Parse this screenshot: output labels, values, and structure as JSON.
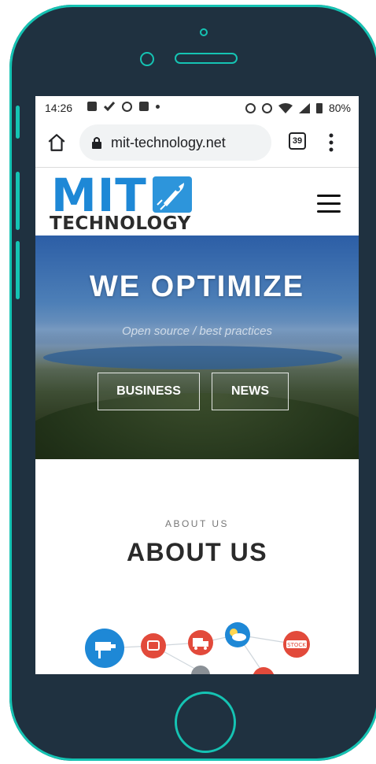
{
  "status_bar": {
    "time": "14:26",
    "battery": "80%"
  },
  "browser": {
    "url": "mit-technology.net",
    "tab_count": "39"
  },
  "site": {
    "logo_primary": "MIT",
    "logo_secondary": "TECHNOLOGY"
  },
  "hero": {
    "title": "WE OPTIMIZE",
    "subtitle": "Open source / best practices",
    "buttons": [
      {
        "label": "BUSINESS"
      },
      {
        "label": "NEWS"
      }
    ]
  },
  "about": {
    "kicker": "ABOUT US",
    "title": "ABOUT US",
    "network_icons": [
      "camera-icon",
      "chat-icon",
      "truck-icon",
      "weather-icon",
      "stock-icon"
    ],
    "network_stock_label": "STOCK"
  },
  "colors": {
    "phone_frame": "#1f3140",
    "phone_accent": "#15c3b3",
    "logo_blue": "#1e88d6",
    "icon_red": "#e24a3b",
    "icon_blue": "#1e88d6"
  }
}
